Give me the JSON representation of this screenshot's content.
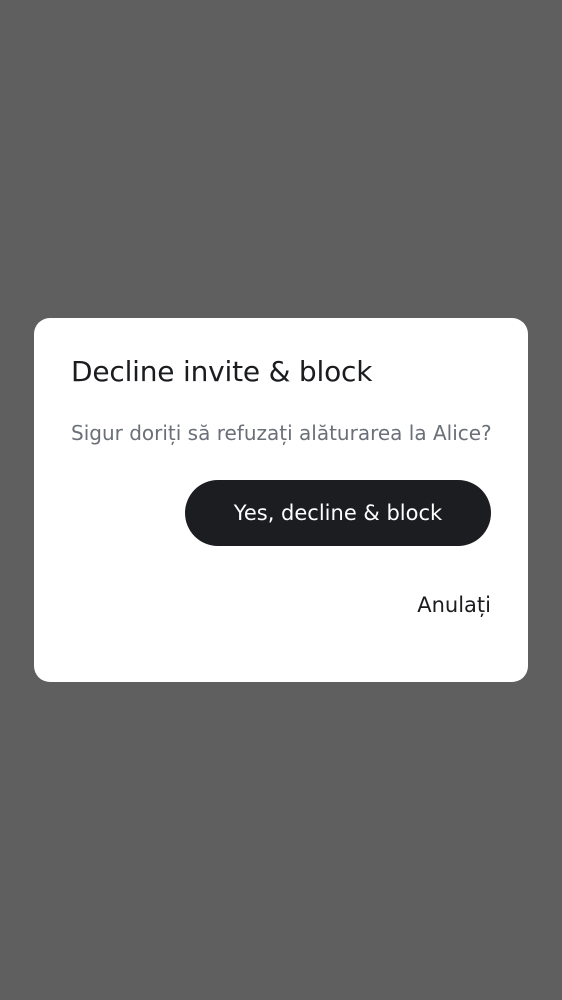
{
  "dialog": {
    "title": "Decline invite & block",
    "message": "Sigur doriți să refuzați alăturarea la Alice?",
    "confirm_label": "Yes, decline & block",
    "cancel_label": "Anulați"
  },
  "colors": {
    "scrim": "#5f5f5f",
    "surface": "#ffffff",
    "primary_button": "#1b1d21",
    "title_text": "#1b1c1f",
    "message_text": "#6b6f78"
  }
}
